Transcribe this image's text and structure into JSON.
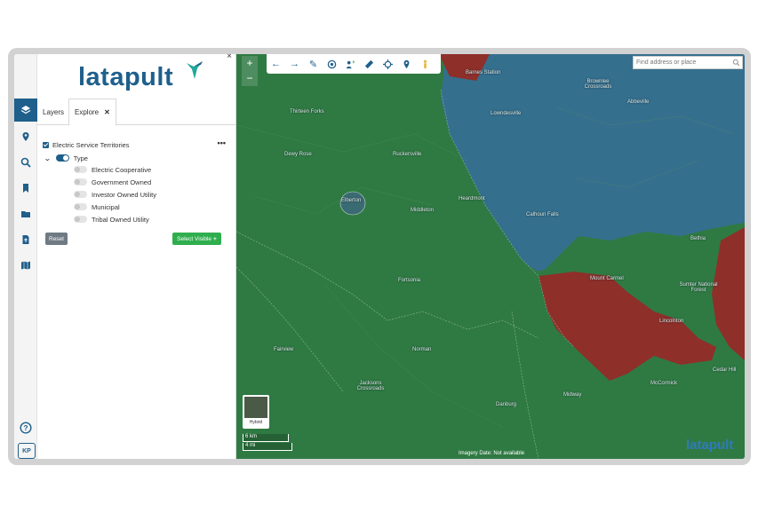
{
  "brand": {
    "name": "latapult",
    "primary": "#1f5f8b",
    "green": "#2fae4e"
  },
  "rail": {
    "items": [
      {
        "name": "layers",
        "icon": "layers-icon"
      },
      {
        "name": "location",
        "icon": "map-pin-icon"
      },
      {
        "name": "search",
        "icon": "search-icon"
      },
      {
        "name": "bookmark",
        "icon": "bookmark-icon"
      },
      {
        "name": "folder",
        "icon": "folder-icon"
      },
      {
        "name": "upload",
        "icon": "file-upload-icon"
      },
      {
        "name": "map",
        "icon": "map-icon"
      }
    ],
    "help_icon": "help-circle-icon",
    "user_initials": "KP"
  },
  "panel": {
    "tabs": [
      {
        "label": "Layers"
      },
      {
        "label": "Explore"
      }
    ],
    "layer_title": "Electric Service Territories",
    "more_label": "•••",
    "type_label": "Type",
    "options": [
      {
        "label": "Electric Cooperative",
        "enabled": false
      },
      {
        "label": "Government Owned",
        "enabled": false
      },
      {
        "label": "Investor Owned Utility",
        "enabled": false
      },
      {
        "label": "Municipal",
        "enabled": false
      },
      {
        "label": "Tribal Owned Utility",
        "enabled": false
      }
    ],
    "reset_label": "Reset",
    "select_visible_label": "Select Visible"
  },
  "map": {
    "search_placeholder": "Find address or place",
    "zoom_in": "+",
    "zoom_out": "−",
    "toolbar": [
      "arrow-left-icon",
      "arrow-right-icon",
      "pencil-icon",
      "buffer-icon",
      "people-pin-icon",
      "ruler-icon",
      "crosshair-icon",
      "location-pin-icon",
      "pegman-icon"
    ],
    "labels": [
      {
        "text": "Thirteen Forks"
      },
      {
        "text": "Dewy Rose"
      },
      {
        "text": "Ruckersville"
      },
      {
        "text": "Elberton"
      },
      {
        "text": "Middleton"
      },
      {
        "text": "Heardmont"
      },
      {
        "text": "Lowndesville"
      },
      {
        "text": "Calhoun Falls"
      },
      {
        "text": "Abbeville"
      },
      {
        "text": "Brownlee Crossroads"
      },
      {
        "text": "Barnes Station"
      },
      {
        "text": "Mount Carmel"
      },
      {
        "text": "Sumter National Forest"
      },
      {
        "text": "Bethia"
      },
      {
        "text": "Fortsonia"
      },
      {
        "text": "Fairview"
      },
      {
        "text": "Norman"
      },
      {
        "text": "Jacksons Crossroads"
      },
      {
        "text": "Danburg"
      },
      {
        "text": "Midway"
      },
      {
        "text": "Lincolnton"
      },
      {
        "text": "Cedar Hill"
      },
      {
        "text": "McCormick"
      }
    ],
    "hybrid_label": "Hybrid",
    "scale_km": "6 km",
    "scale_mi": "4 mi",
    "credit": "Imagery Date: Not available",
    "watermark": "latapult",
    "colors": {
      "green_region": "#2f7a43",
      "blue_region": "#356f8e",
      "red_region": "#8e2f2a"
    }
  }
}
